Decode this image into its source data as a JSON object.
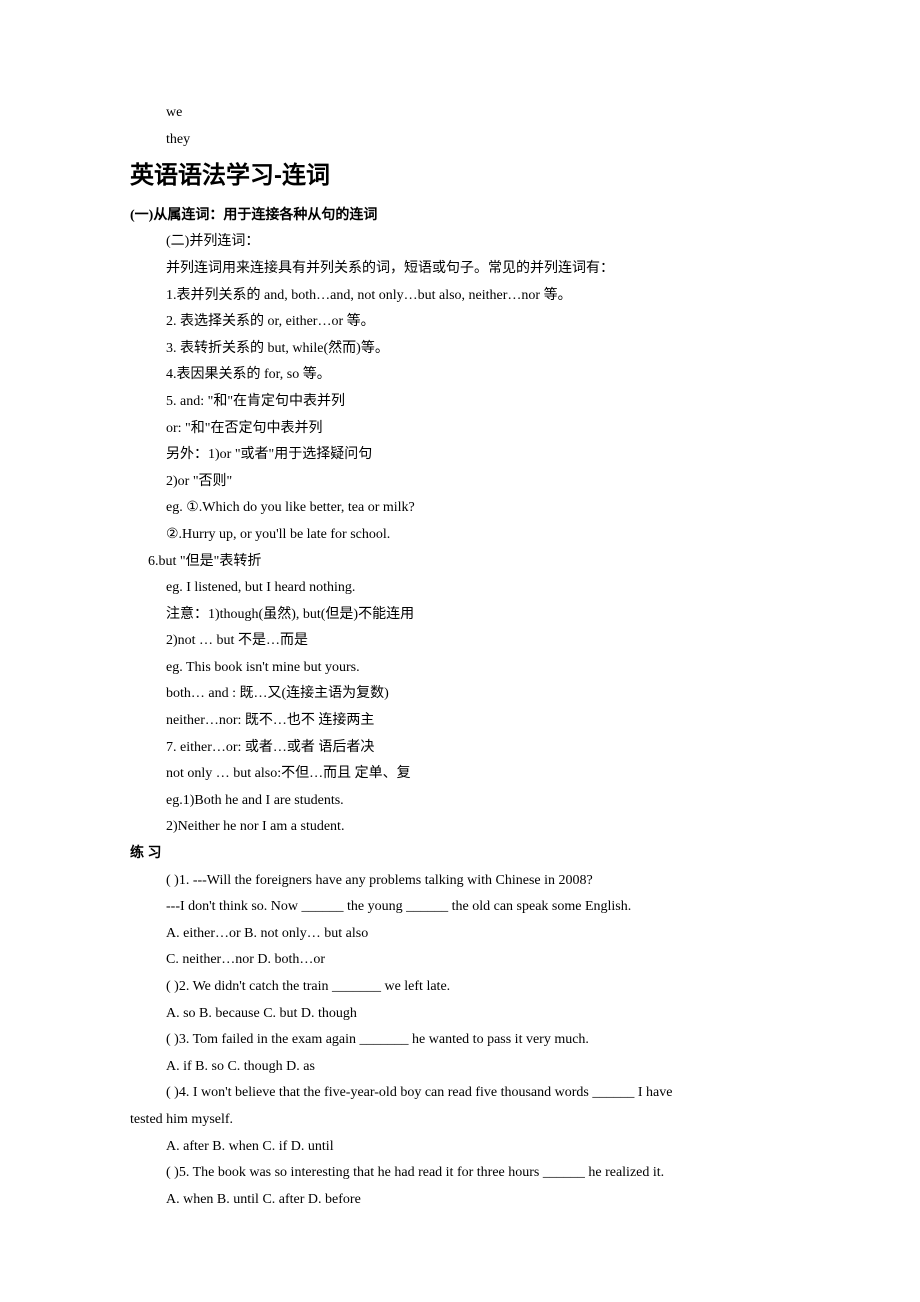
{
  "pre": {
    "l1": "we",
    "l2": "they"
  },
  "title": "英语语法学习-连词",
  "h1": "(一)从属连词：用于连接各种从句的连词",
  "p1": "(二)并列连词：",
  "p2": "并列连词用来连接具有并列关系的词，短语或句子。常见的并列连词有：",
  "p3": "1.表并列关系的 and, both…and, not only…but also, neither…nor 等。",
  "p4": "2. 表选择关系的 or, either…or 等。",
  "p5": "3. 表转折关系的 but, while(然而)等。",
  "p6": "4.表因果关系的 for, so 等。",
  "p7": "5. and: \"和\"在肯定句中表并列",
  "p8": "or: \"和\"在否定句中表并列",
  "p9": "另外：1)or \"或者\"用于选择疑问句",
  "p10": "2)or \"否则\"",
  "p11": "eg. ①.Which do you like better, tea or milk?",
  "p12": "②.Hurry up, or you'll be late for school.",
  "p13": "6.but \"但是\"表转折",
  "p14": "eg. I listened, but I heard nothing.",
  "p15": "注意：1)though(虽然), but(但是)不能连用",
  "p16": "2)not … but 不是…而是",
  "p17": "eg. This book isn't mine but yours.",
  "p18": "both… and : 既…又(连接主语为复数)",
  "p19": "neither…nor: 既不…也不 连接两主",
  "p20": "7. either…or: 或者…或者 语后者决",
  "p21": "not only … but also:不但…而且 定单、复",
  "p22": "eg.1)Both he and I are students.",
  "p23": "2)Neither he nor I am a student.",
  "h2": "练 习",
  "q1a": "( )1. ---Will the foreigners have any problems talking with Chinese in 2008?",
  "q1b": "---I don't think so. Now ______ the young ______ the old can speak some English.",
  "q1c": "A. either…or B. not only… but also",
  "q1d": "C. neither…nor D. both…or",
  "q2a": "( )2. We didn't catch the train _______ we left late.",
  "q2b": "A. so B. because C. but D. though",
  "q3a": "( )3. Tom failed in the exam again _______ he wanted to pass it very much.",
  "q3b": "A. if B. so C. though D. as",
  "q4a": "( )4. I won't believe that the five-year-old boy can read five thousand words ______ I have",
  "q4a2": "tested him myself.",
  "q4b": "A. after B. when C. if D. until",
  "q5a": "( )5. The book was so interesting that he had read it for three hours ______ he realized it.",
  "q5b": "A. when B. until C. after D. before"
}
